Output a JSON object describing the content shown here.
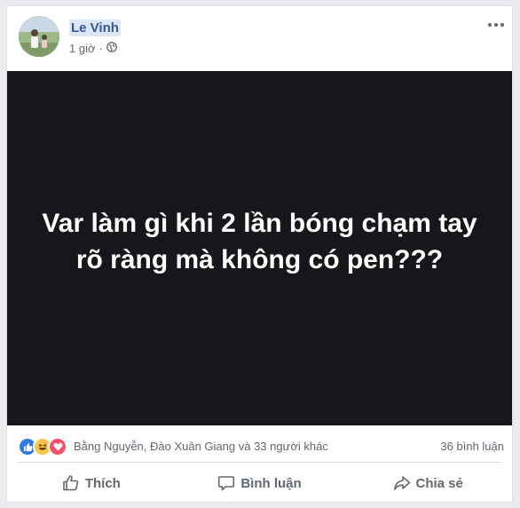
{
  "post": {
    "author": "Le Vinh",
    "time": "1 giờ",
    "privacy_icon": "globe-icon",
    "image_text": "Var làm gì khi 2 lần bóng chạm tay rõ ràng mà không có pen???",
    "image_bg": "#16171a"
  },
  "stats": {
    "reaction_icons": [
      "like-reaction-icon",
      "haha-reaction-icon",
      "love-reaction-icon"
    ],
    "reactors": "Bằng Nguyễn, Đào Xuân Giang và 33 người khác",
    "comments": "36 bình luận"
  },
  "actions": {
    "like": "Thích",
    "comment": "Bình luận",
    "share": "Chia sẻ"
  },
  "colors": {
    "author_link": "#365899",
    "meta_text": "#606770",
    "like_blue": "#3578e5",
    "love_red": "#f25268",
    "haha_yellow": "#f7c64a"
  }
}
